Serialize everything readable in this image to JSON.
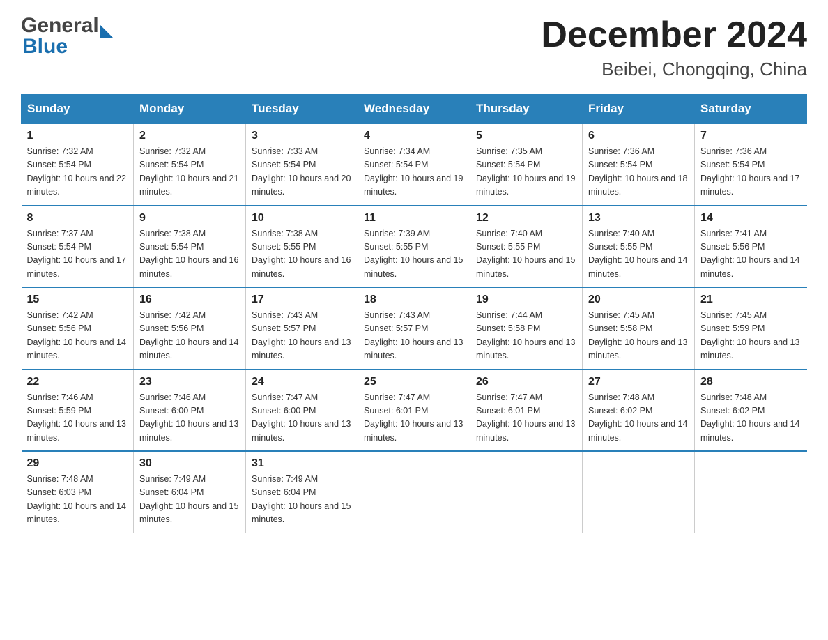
{
  "header": {
    "logo_general": "General",
    "logo_blue": "Blue",
    "title": "December 2024",
    "subtitle": "Beibei, Chongqing, China"
  },
  "weekdays": [
    "Sunday",
    "Monday",
    "Tuesday",
    "Wednesday",
    "Thursday",
    "Friday",
    "Saturday"
  ],
  "weeks": [
    [
      {
        "day": "1",
        "sunrise": "7:32 AM",
        "sunset": "5:54 PM",
        "daylight": "10 hours and 22 minutes."
      },
      {
        "day": "2",
        "sunrise": "7:32 AM",
        "sunset": "5:54 PM",
        "daylight": "10 hours and 21 minutes."
      },
      {
        "day": "3",
        "sunrise": "7:33 AM",
        "sunset": "5:54 PM",
        "daylight": "10 hours and 20 minutes."
      },
      {
        "day": "4",
        "sunrise": "7:34 AM",
        "sunset": "5:54 PM",
        "daylight": "10 hours and 19 minutes."
      },
      {
        "day": "5",
        "sunrise": "7:35 AM",
        "sunset": "5:54 PM",
        "daylight": "10 hours and 19 minutes."
      },
      {
        "day": "6",
        "sunrise": "7:36 AM",
        "sunset": "5:54 PM",
        "daylight": "10 hours and 18 minutes."
      },
      {
        "day": "7",
        "sunrise": "7:36 AM",
        "sunset": "5:54 PM",
        "daylight": "10 hours and 17 minutes."
      }
    ],
    [
      {
        "day": "8",
        "sunrise": "7:37 AM",
        "sunset": "5:54 PM",
        "daylight": "10 hours and 17 minutes."
      },
      {
        "day": "9",
        "sunrise": "7:38 AM",
        "sunset": "5:54 PM",
        "daylight": "10 hours and 16 minutes."
      },
      {
        "day": "10",
        "sunrise": "7:38 AM",
        "sunset": "5:55 PM",
        "daylight": "10 hours and 16 minutes."
      },
      {
        "day": "11",
        "sunrise": "7:39 AM",
        "sunset": "5:55 PM",
        "daylight": "10 hours and 15 minutes."
      },
      {
        "day": "12",
        "sunrise": "7:40 AM",
        "sunset": "5:55 PM",
        "daylight": "10 hours and 15 minutes."
      },
      {
        "day": "13",
        "sunrise": "7:40 AM",
        "sunset": "5:55 PM",
        "daylight": "10 hours and 14 minutes."
      },
      {
        "day": "14",
        "sunrise": "7:41 AM",
        "sunset": "5:56 PM",
        "daylight": "10 hours and 14 minutes."
      }
    ],
    [
      {
        "day": "15",
        "sunrise": "7:42 AM",
        "sunset": "5:56 PM",
        "daylight": "10 hours and 14 minutes."
      },
      {
        "day": "16",
        "sunrise": "7:42 AM",
        "sunset": "5:56 PM",
        "daylight": "10 hours and 14 minutes."
      },
      {
        "day": "17",
        "sunrise": "7:43 AM",
        "sunset": "5:57 PM",
        "daylight": "10 hours and 13 minutes."
      },
      {
        "day": "18",
        "sunrise": "7:43 AM",
        "sunset": "5:57 PM",
        "daylight": "10 hours and 13 minutes."
      },
      {
        "day": "19",
        "sunrise": "7:44 AM",
        "sunset": "5:58 PM",
        "daylight": "10 hours and 13 minutes."
      },
      {
        "day": "20",
        "sunrise": "7:45 AM",
        "sunset": "5:58 PM",
        "daylight": "10 hours and 13 minutes."
      },
      {
        "day": "21",
        "sunrise": "7:45 AM",
        "sunset": "5:59 PM",
        "daylight": "10 hours and 13 minutes."
      }
    ],
    [
      {
        "day": "22",
        "sunrise": "7:46 AM",
        "sunset": "5:59 PM",
        "daylight": "10 hours and 13 minutes."
      },
      {
        "day": "23",
        "sunrise": "7:46 AM",
        "sunset": "6:00 PM",
        "daylight": "10 hours and 13 minutes."
      },
      {
        "day": "24",
        "sunrise": "7:47 AM",
        "sunset": "6:00 PM",
        "daylight": "10 hours and 13 minutes."
      },
      {
        "day": "25",
        "sunrise": "7:47 AM",
        "sunset": "6:01 PM",
        "daylight": "10 hours and 13 minutes."
      },
      {
        "day": "26",
        "sunrise": "7:47 AM",
        "sunset": "6:01 PM",
        "daylight": "10 hours and 13 minutes."
      },
      {
        "day": "27",
        "sunrise": "7:48 AM",
        "sunset": "6:02 PM",
        "daylight": "10 hours and 14 minutes."
      },
      {
        "day": "28",
        "sunrise": "7:48 AM",
        "sunset": "6:02 PM",
        "daylight": "10 hours and 14 minutes."
      }
    ],
    [
      {
        "day": "29",
        "sunrise": "7:48 AM",
        "sunset": "6:03 PM",
        "daylight": "10 hours and 14 minutes."
      },
      {
        "day": "30",
        "sunrise": "7:49 AM",
        "sunset": "6:04 PM",
        "daylight": "10 hours and 15 minutes."
      },
      {
        "day": "31",
        "sunrise": "7:49 AM",
        "sunset": "6:04 PM",
        "daylight": "10 hours and 15 minutes."
      },
      null,
      null,
      null,
      null
    ]
  ],
  "labels": {
    "sunrise": "Sunrise: ",
    "sunset": "Sunset: ",
    "daylight": "Daylight: "
  }
}
